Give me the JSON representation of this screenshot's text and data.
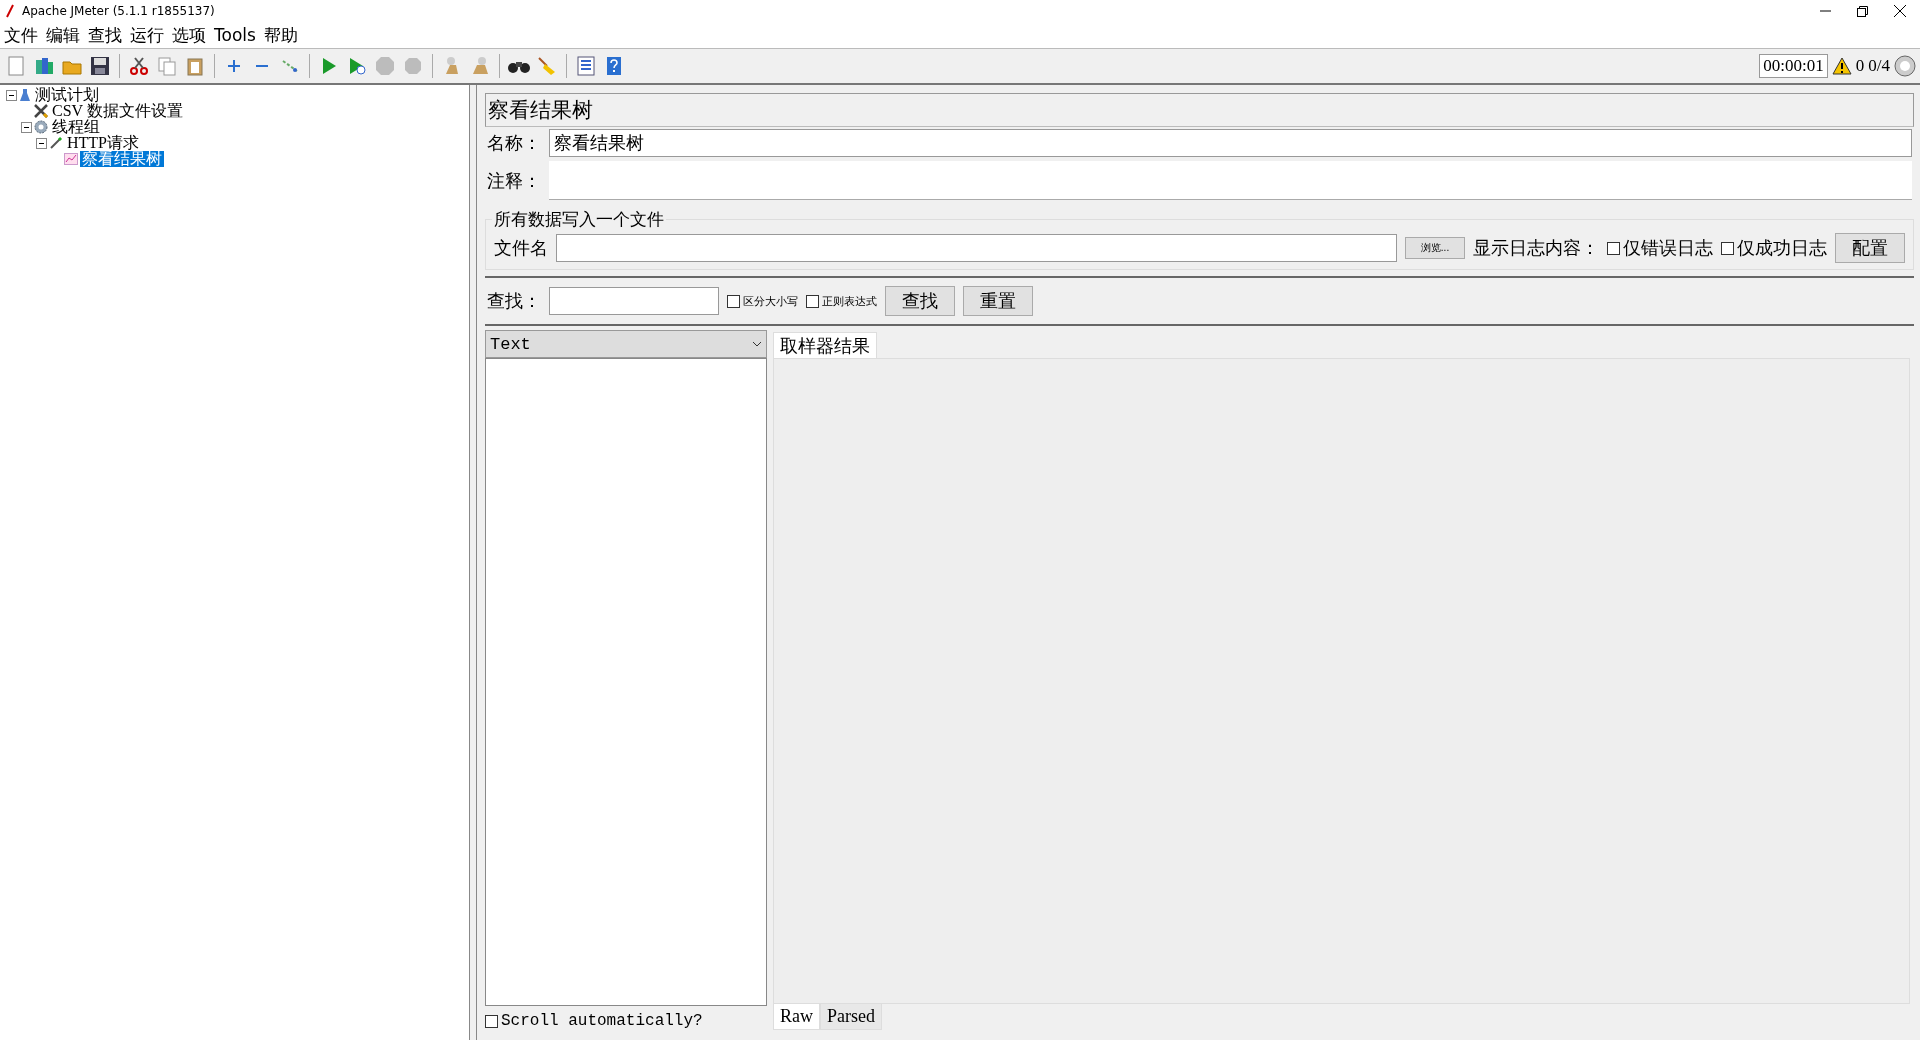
{
  "window": {
    "title": "Apache JMeter (5.1.1 r1855137)"
  },
  "menu": [
    "文件",
    "编辑",
    "查找",
    "运行",
    "选项",
    "Tools",
    "帮助"
  ],
  "toolbar": [
    {
      "kind": "new",
      "disabled": false
    },
    {
      "kind": "templates",
      "disabled": false
    },
    {
      "kind": "open",
      "disabled": false
    },
    {
      "kind": "save",
      "disabled": false
    },
    {
      "kind": "sep"
    },
    {
      "kind": "cut",
      "disabled": false
    },
    {
      "kind": "copy",
      "disabled": false
    },
    {
      "kind": "paste",
      "disabled": false
    },
    {
      "kind": "sep"
    },
    {
      "kind": "expand",
      "disabled": false
    },
    {
      "kind": "collapse",
      "disabled": false
    },
    {
      "kind": "toggle",
      "disabled": false
    },
    {
      "kind": "sep"
    },
    {
      "kind": "start",
      "disabled": false
    },
    {
      "kind": "startnopause",
      "disabled": false
    },
    {
      "kind": "stop",
      "disabled": true
    },
    {
      "kind": "shutdown",
      "disabled": true
    },
    {
      "kind": "sep"
    },
    {
      "kind": "clear",
      "disabled": false
    },
    {
      "kind": "clearall",
      "disabled": false
    },
    {
      "kind": "sep"
    },
    {
      "kind": "search",
      "disabled": false
    },
    {
      "kind": "reset",
      "disabled": false
    },
    {
      "kind": "sep"
    },
    {
      "kind": "functions",
      "disabled": false
    },
    {
      "kind": "help",
      "disabled": false
    }
  ],
  "status": {
    "elapsed": "00:00:01",
    "warnings": "0",
    "threads": "0/4"
  },
  "tree": [
    {
      "label": "测试计划",
      "kind": "plan",
      "selected": false,
      "expanded": true,
      "children": [
        {
          "label": "CSV  数据文件设置",
          "kind": "config",
          "selected": false
        },
        {
          "label": "线程组",
          "kind": "threads",
          "selected": false,
          "expanded": true,
          "children": [
            {
              "label": "HTTP请求",
              "kind": "sampler",
              "selected": false,
              "expanded": true,
              "children": [
                {
                  "label": "察看结果树",
                  "kind": "listener",
                  "selected": true
                }
              ]
            }
          ]
        }
      ]
    }
  ],
  "panel": {
    "title": "察看结果树",
    "name_label": "名称：",
    "name_value": "察看结果树",
    "comment_label": "注释：",
    "file_group": {
      "title": "所有数据写入一个文件",
      "filename_label": "文件名",
      "browse": "浏览...",
      "log_label": "显示日志内容：",
      "errors_only": {
        "label": "仅错误日志",
        "checked": false
      },
      "success_only": {
        "label": "仅成功日志",
        "checked": false
      },
      "configure": "配置"
    },
    "search": {
      "label": "查找：",
      "case_sensitive": {
        "label": "区分大小写",
        "checked": false
      },
      "regex": {
        "label": "正则表达式",
        "checked": false
      },
      "find": "查找",
      "reset": "重置"
    },
    "renderer": "Text",
    "scroll": {
      "label": "Scroll automatically?",
      "checked": false
    },
    "tabs": [
      {
        "label": "取样器结果",
        "selected": true
      }
    ],
    "bottom_tabs": [
      {
        "label": "Raw",
        "selected": true
      },
      {
        "label": "Parsed",
        "selected": false
      }
    ]
  }
}
